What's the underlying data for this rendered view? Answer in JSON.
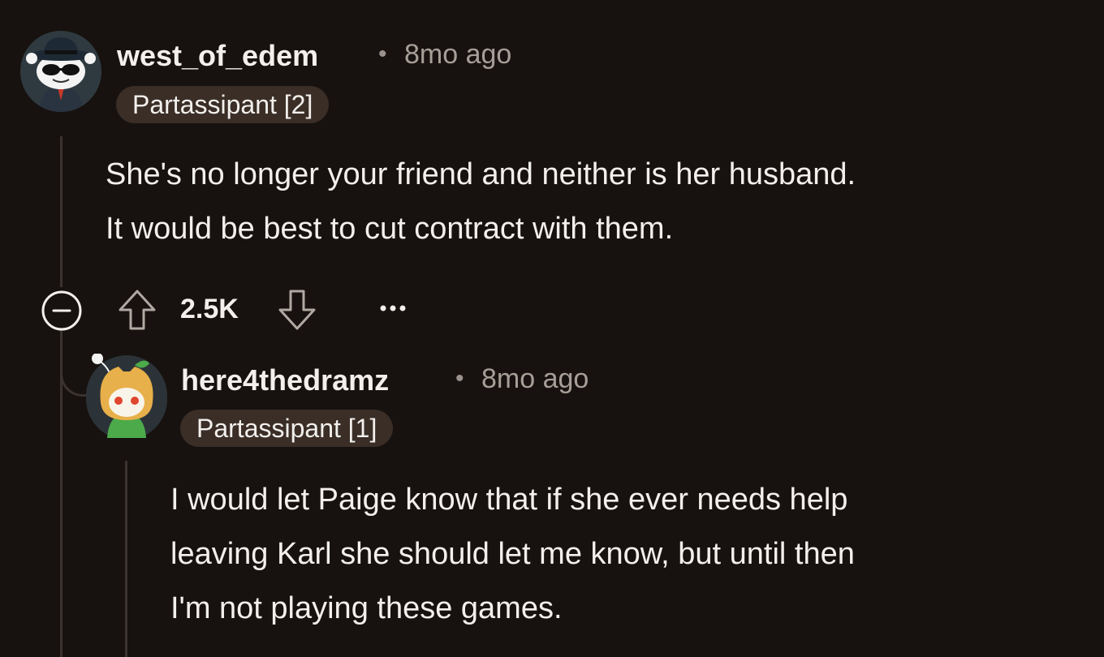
{
  "comments": [
    {
      "username": "west_of_edem",
      "separator": "•",
      "time": "8mo ago",
      "flair": "Partassipant [2]",
      "lines": [
        "She's no longer your friend and neither is her husband.",
        "It would be best to cut contract with them."
      ],
      "score": "2.5K",
      "avatar_icon": "panda-agent-avatar"
    },
    {
      "username": "here4thedramz",
      "separator": "•",
      "time": "8mo ago",
      "flair": "Partassipant [1]",
      "lines": [
        "I would let Paige know that if she ever needs help",
        "leaving Karl she should let me know, but until then",
        "I'm not playing these games."
      ],
      "avatar_icon": "shiba-costume-avatar"
    }
  ],
  "colors": {
    "background": "#17120f",
    "flair_bg": "#3a2e27",
    "thread_line": "#3a3330",
    "muted_text": "#a79e98"
  }
}
